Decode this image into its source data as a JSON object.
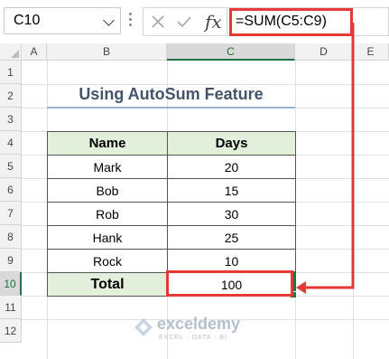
{
  "formula_bar": {
    "name_box": "C10",
    "fx_label": "fx",
    "formula": "=SUM(C5:C9)"
  },
  "columns": [
    "A",
    "B",
    "C",
    "D",
    "E"
  ],
  "rows": [
    "1",
    "2",
    "3",
    "4",
    "5",
    "6",
    "7",
    "8",
    "9",
    "10",
    "11",
    "12"
  ],
  "title": "Using AutoSum Feature",
  "table": {
    "headers": [
      "Name",
      "Days"
    ],
    "rows": [
      [
        "Mark",
        "20"
      ],
      [
        "Bob",
        "15"
      ],
      [
        "Rob",
        "30"
      ],
      [
        "Hank",
        "25"
      ],
      [
        "Rock",
        "10"
      ]
    ],
    "total_label": "Total",
    "total_value": "100"
  },
  "watermark": {
    "name": "exceldemy",
    "tagline": "EXCEL · DATA · BI"
  },
  "colors": {
    "accent_red": "#e53935",
    "header_fill": "#e2efda",
    "selection_green": "#217346"
  }
}
